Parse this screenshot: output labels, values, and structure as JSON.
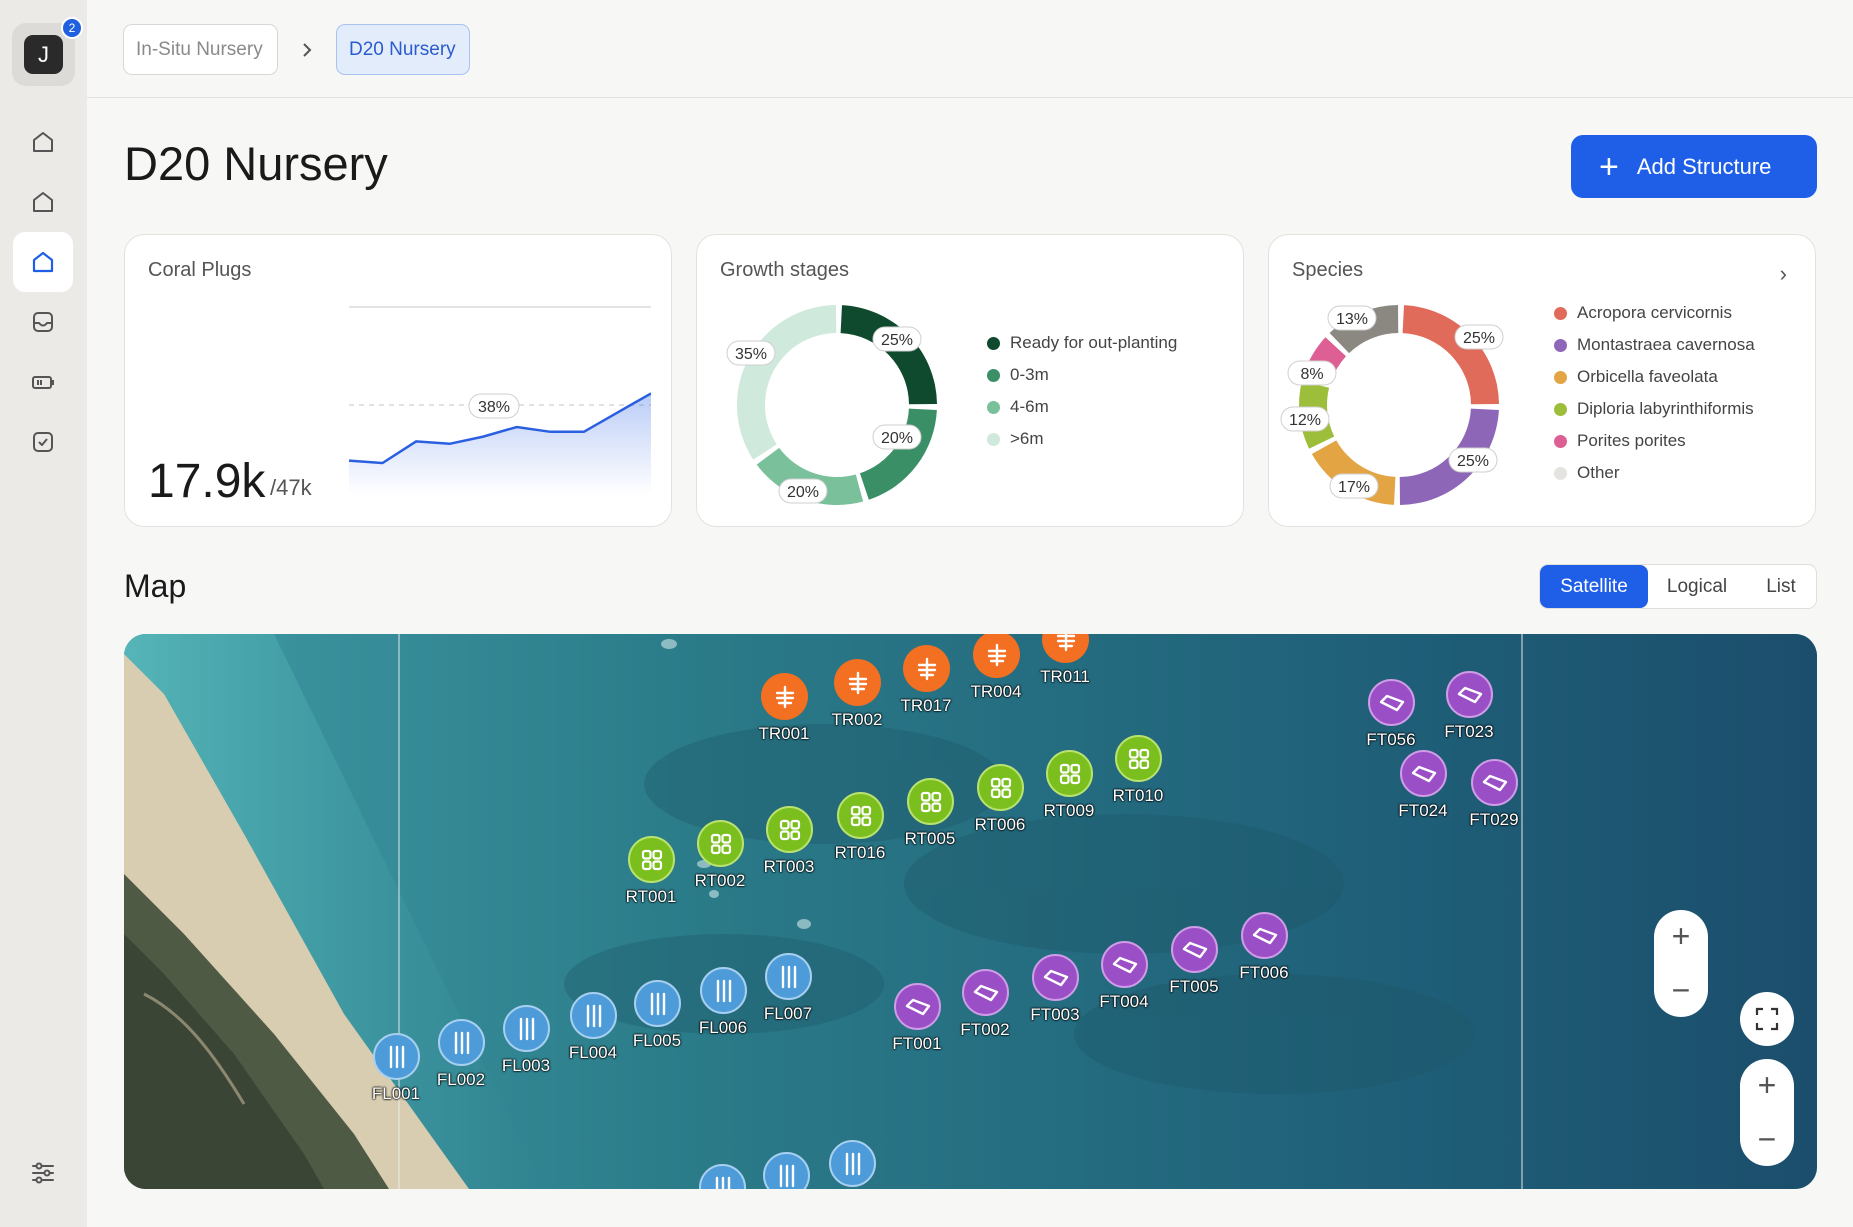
{
  "sidebar": {
    "avatar_initial": "J",
    "badge_count": "2",
    "nav": [
      {
        "name": "home-icon-1",
        "active": false
      },
      {
        "name": "home-icon-2",
        "active": false
      },
      {
        "name": "home-icon-3",
        "active": true
      },
      {
        "name": "inbox-icon",
        "active": false
      },
      {
        "name": "battery-icon",
        "active": false
      },
      {
        "name": "checkbox-icon",
        "active": false
      }
    ],
    "settings_icon": "sliders-icon"
  },
  "breadcrumb": {
    "items": [
      "In-Situ Nursery",
      "D20 Nursery"
    ]
  },
  "header": {
    "title": "D20 Nursery",
    "add_button": "Add Structure"
  },
  "coral_plugs": {
    "title": "Coral Plugs",
    "value": "17.9k",
    "total": "/47k",
    "callout": "38%",
    "trend": [
      0.12,
      0.1,
      0.28,
      0.26,
      0.32,
      0.4,
      0.36,
      0.36,
      0.52,
      0.68
    ]
  },
  "growth_stages": {
    "title": "Growth stages",
    "legend": [
      {
        "label": "Ready for out-planting",
        "color": "#0f4a2e"
      },
      {
        "label": "0-3m",
        "color": "#3a8f66"
      },
      {
        "label": "4-6m",
        "color": "#79c09b"
      },
      {
        "label": ">6m",
        "color": "#cfe9dc"
      }
    ],
    "labels": [
      "25%",
      "20%",
      "20%",
      "35%"
    ],
    "values": [
      25,
      20,
      20,
      35
    ]
  },
  "species": {
    "title": "Species",
    "legend": [
      {
        "label": "Acropora cervicornis",
        "color": "#e06b5a"
      },
      {
        "label": "Montastraea cavernosa",
        "color": "#8e66b8"
      },
      {
        "label": "Orbicella faveolata",
        "color": "#e3a444"
      },
      {
        "label": "Diploria labyrinthiformis",
        "color": "#9cbe3a"
      },
      {
        "label": "Porites porites",
        "color": "#dd5f93"
      },
      {
        "label": "Other",
        "color": "#e4e3e0"
      }
    ],
    "labels": [
      "25%",
      "25%",
      "17%",
      "12%",
      "8%",
      "13%"
    ],
    "values": [
      25,
      25,
      17,
      12,
      8,
      13
    ],
    "other_color": "#8a8880"
  },
  "map": {
    "title": "Map",
    "views": [
      "Satellite",
      "Logical",
      "List"
    ],
    "active_view": "Satellite",
    "markers": {
      "TR": [
        "TR001",
        "TR002",
        "TR017",
        "TR004",
        "TR011"
      ],
      "RT": [
        "RT001",
        "RT002",
        "RT003",
        "RT016",
        "RT005",
        "RT006",
        "RT009",
        "RT010"
      ],
      "FL": [
        "FL001",
        "FL002",
        "FL003",
        "FL004",
        "FL005",
        "FL006",
        "FL007"
      ],
      "FT": [
        "FT001",
        "FT002",
        "FT003",
        "FT004",
        "FT005",
        "FT006",
        "FT056",
        "FT023",
        "FT024",
        "FT029"
      ]
    },
    "zoom_in": "+",
    "zoom_out": "−"
  }
}
